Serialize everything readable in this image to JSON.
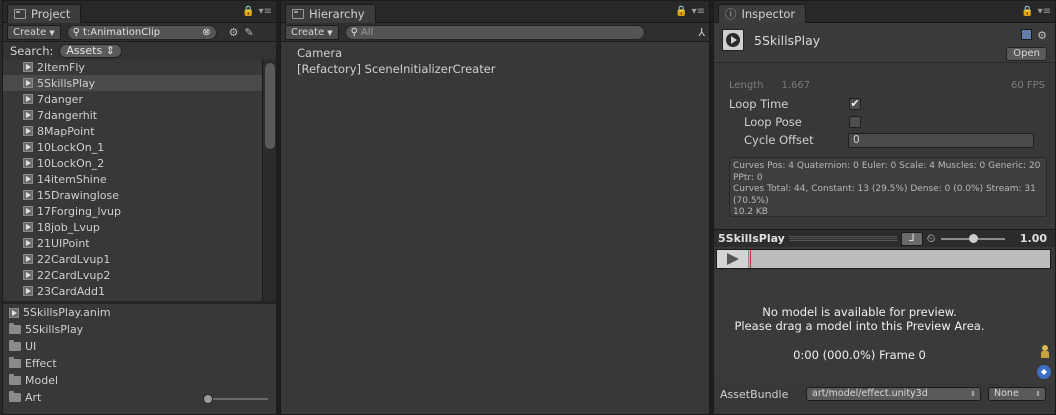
{
  "project": {
    "tab_label": "Project",
    "create_label": "Create",
    "search_value": "t:AnimationClip",
    "search_label": "Search:",
    "scope_label": "Assets",
    "clips": [
      "2ItemFly",
      "5SkillsPlay",
      "7danger",
      "7dangerhit",
      "8MapPoint",
      "10LockOn_1",
      "10LockOn_2",
      "14itemShine",
      "15Drawinglose",
      "17Forging_lvup",
      "18job_Lvup",
      "21UIPoint",
      "22CardLvup1",
      "22CardLvup2",
      "23CardAdd1"
    ],
    "selected_clip": "5SkillsPlay",
    "bottom_items": [
      {
        "label": "5SkillsPlay.anim",
        "icon": "anim-clip-icon"
      },
      {
        "label": "5SkillsPlay",
        "icon": "folder-icon"
      },
      {
        "label": "UI",
        "icon": "folder-icon"
      },
      {
        "label": "Effect",
        "icon": "folder-icon"
      },
      {
        "label": "Model",
        "icon": "folder-icon"
      },
      {
        "label": "Art",
        "icon": "folder-icon"
      }
    ]
  },
  "hierarchy": {
    "tab_label": "Hierarchy",
    "create_label": "Create",
    "search_placeholder": "All",
    "items": [
      "Camera",
      "[Refactory] SceneInitializerCreater"
    ]
  },
  "inspector": {
    "tab_label": "Inspector",
    "asset_name": "5SkillsPlay",
    "open_label": "Open",
    "length_label": "Length",
    "length_value": "1.667",
    "fps_label": "60 FPS",
    "loop_time_label": "Loop Time",
    "loop_time_checked": true,
    "loop_pose_label": "Loop Pose",
    "loop_pose_checked": false,
    "cycle_offset_label": "Cycle Offset",
    "cycle_offset_value": "0",
    "info_line1": "Curves Pos: 4 Quaternion: 0 Euler: 0 Scale: 4 Muscles: 0 Generic: 20 PPtr: 0",
    "info_line2": "Curves Total: 44, Constant: 13 (29.5%) Dense: 0 (0.0%) Stream: 31 (70.5%)",
    "info_line3": "10.2 KB",
    "preview_clip_name": "5SkillsPlay",
    "speed_value": "1.00",
    "preview_msg_line1": "No model is available for preview.",
    "preview_msg_line2": "Please drag a model into this Preview Area.",
    "frame_info": "0:00 (000.0%) Frame 0",
    "assetbundle_label": "AssetBundle",
    "assetbundle_value": "art/model/effect.unity3d",
    "variant_value": "None"
  }
}
